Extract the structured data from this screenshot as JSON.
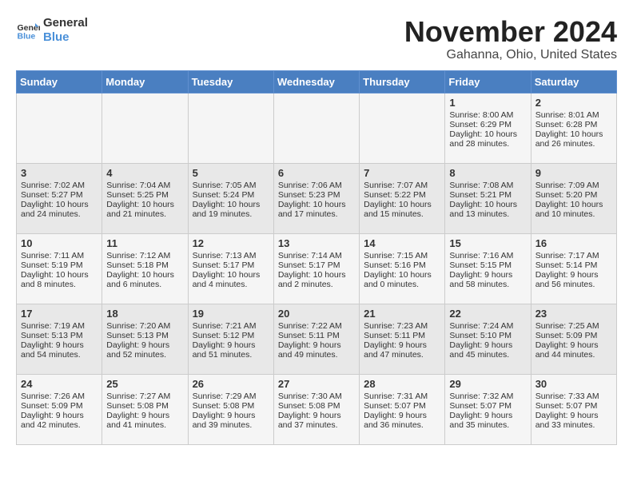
{
  "logo": {
    "line1": "General",
    "line2": "Blue"
  },
  "title": "November 2024",
  "location": "Gahanna, Ohio, United States",
  "weekdays": [
    "Sunday",
    "Monday",
    "Tuesday",
    "Wednesday",
    "Thursday",
    "Friday",
    "Saturday"
  ],
  "weeks": [
    [
      {
        "day": "",
        "info": ""
      },
      {
        "day": "",
        "info": ""
      },
      {
        "day": "",
        "info": ""
      },
      {
        "day": "",
        "info": ""
      },
      {
        "day": "",
        "info": ""
      },
      {
        "day": "1",
        "info": "Sunrise: 8:00 AM\nSunset: 6:29 PM\nDaylight: 10 hours and 28 minutes."
      },
      {
        "day": "2",
        "info": "Sunrise: 8:01 AM\nSunset: 6:28 PM\nDaylight: 10 hours and 26 minutes."
      }
    ],
    [
      {
        "day": "3",
        "info": "Sunrise: 7:02 AM\nSunset: 5:27 PM\nDaylight: 10 hours and 24 minutes."
      },
      {
        "day": "4",
        "info": "Sunrise: 7:04 AM\nSunset: 5:25 PM\nDaylight: 10 hours and 21 minutes."
      },
      {
        "day": "5",
        "info": "Sunrise: 7:05 AM\nSunset: 5:24 PM\nDaylight: 10 hours and 19 minutes."
      },
      {
        "day": "6",
        "info": "Sunrise: 7:06 AM\nSunset: 5:23 PM\nDaylight: 10 hours and 17 minutes."
      },
      {
        "day": "7",
        "info": "Sunrise: 7:07 AM\nSunset: 5:22 PM\nDaylight: 10 hours and 15 minutes."
      },
      {
        "day": "8",
        "info": "Sunrise: 7:08 AM\nSunset: 5:21 PM\nDaylight: 10 hours and 13 minutes."
      },
      {
        "day": "9",
        "info": "Sunrise: 7:09 AM\nSunset: 5:20 PM\nDaylight: 10 hours and 10 minutes."
      }
    ],
    [
      {
        "day": "10",
        "info": "Sunrise: 7:11 AM\nSunset: 5:19 PM\nDaylight: 10 hours and 8 minutes."
      },
      {
        "day": "11",
        "info": "Sunrise: 7:12 AM\nSunset: 5:18 PM\nDaylight: 10 hours and 6 minutes."
      },
      {
        "day": "12",
        "info": "Sunrise: 7:13 AM\nSunset: 5:17 PM\nDaylight: 10 hours and 4 minutes."
      },
      {
        "day": "13",
        "info": "Sunrise: 7:14 AM\nSunset: 5:17 PM\nDaylight: 10 hours and 2 minutes."
      },
      {
        "day": "14",
        "info": "Sunrise: 7:15 AM\nSunset: 5:16 PM\nDaylight: 10 hours and 0 minutes."
      },
      {
        "day": "15",
        "info": "Sunrise: 7:16 AM\nSunset: 5:15 PM\nDaylight: 9 hours and 58 minutes."
      },
      {
        "day": "16",
        "info": "Sunrise: 7:17 AM\nSunset: 5:14 PM\nDaylight: 9 hours and 56 minutes."
      }
    ],
    [
      {
        "day": "17",
        "info": "Sunrise: 7:19 AM\nSunset: 5:13 PM\nDaylight: 9 hours and 54 minutes."
      },
      {
        "day": "18",
        "info": "Sunrise: 7:20 AM\nSunset: 5:13 PM\nDaylight: 9 hours and 52 minutes."
      },
      {
        "day": "19",
        "info": "Sunrise: 7:21 AM\nSunset: 5:12 PM\nDaylight: 9 hours and 51 minutes."
      },
      {
        "day": "20",
        "info": "Sunrise: 7:22 AM\nSunset: 5:11 PM\nDaylight: 9 hours and 49 minutes."
      },
      {
        "day": "21",
        "info": "Sunrise: 7:23 AM\nSunset: 5:11 PM\nDaylight: 9 hours and 47 minutes."
      },
      {
        "day": "22",
        "info": "Sunrise: 7:24 AM\nSunset: 5:10 PM\nDaylight: 9 hours and 45 minutes."
      },
      {
        "day": "23",
        "info": "Sunrise: 7:25 AM\nSunset: 5:09 PM\nDaylight: 9 hours and 44 minutes."
      }
    ],
    [
      {
        "day": "24",
        "info": "Sunrise: 7:26 AM\nSunset: 5:09 PM\nDaylight: 9 hours and 42 minutes."
      },
      {
        "day": "25",
        "info": "Sunrise: 7:27 AM\nSunset: 5:08 PM\nDaylight: 9 hours and 41 minutes."
      },
      {
        "day": "26",
        "info": "Sunrise: 7:29 AM\nSunset: 5:08 PM\nDaylight: 9 hours and 39 minutes."
      },
      {
        "day": "27",
        "info": "Sunrise: 7:30 AM\nSunset: 5:08 PM\nDaylight: 9 hours and 37 minutes."
      },
      {
        "day": "28",
        "info": "Sunrise: 7:31 AM\nSunset: 5:07 PM\nDaylight: 9 hours and 36 minutes."
      },
      {
        "day": "29",
        "info": "Sunrise: 7:32 AM\nSunset: 5:07 PM\nDaylight: 9 hours and 35 minutes."
      },
      {
        "day": "30",
        "info": "Sunrise: 7:33 AM\nSunset: 5:07 PM\nDaylight: 9 hours and 33 minutes."
      }
    ]
  ]
}
